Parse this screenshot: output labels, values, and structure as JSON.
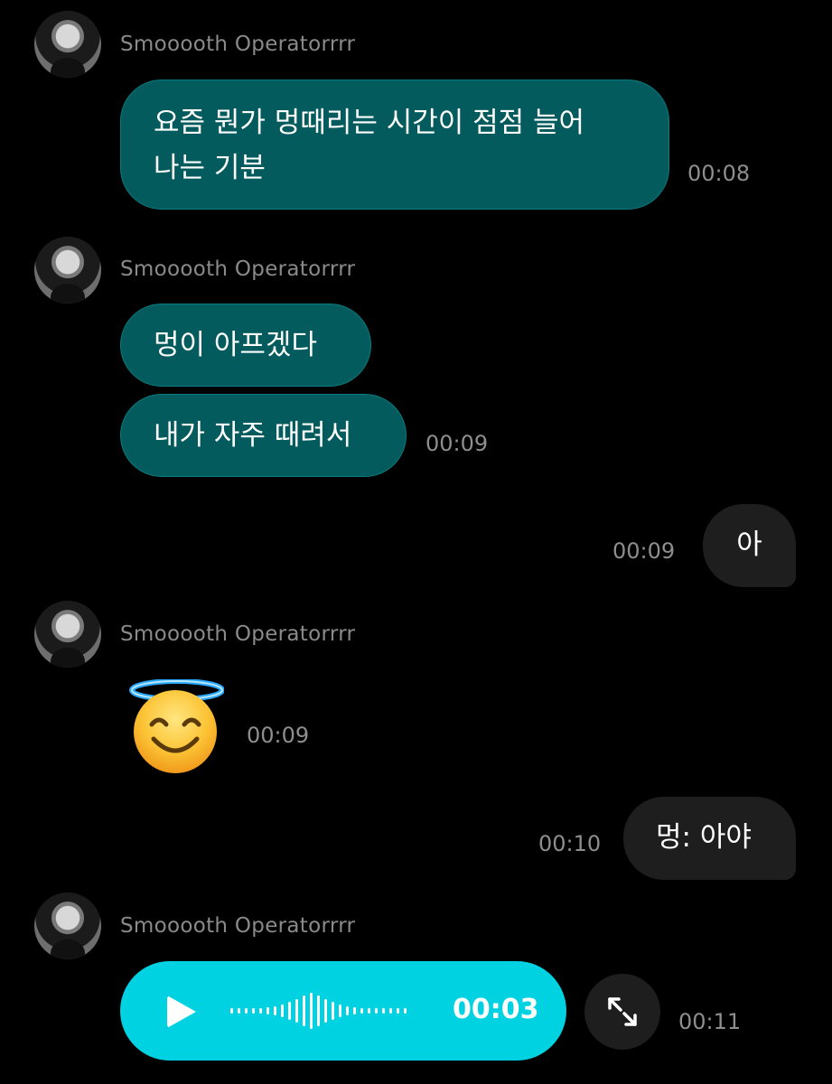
{
  "sender_name": "Smooooth Operatorrrr",
  "messages": {
    "m1": {
      "text_line1": "요즘 뭔가 멍때리는 시간이 점점 늘어",
      "text_line2": "나는 기분",
      "time": "00:08"
    },
    "m2": {
      "text": "멍이 아프겠다"
    },
    "m3": {
      "text": "내가 자주 때려서",
      "time": "00:09"
    },
    "m4": {
      "text": "아",
      "time": "00:09"
    },
    "m5": {
      "emoji": "smiling-face-with-halo",
      "time": "00:09"
    },
    "m6": {
      "text": "멍: 아야",
      "time": "00:10"
    },
    "m7": {
      "voice_duration": "00:03",
      "time": "00:11"
    }
  },
  "colors": {
    "incoming_bubble": "#035b5e",
    "outgoing_bubble": "#1e1e1e",
    "voice_bubble": "#00d2e2",
    "background": "#000000"
  }
}
